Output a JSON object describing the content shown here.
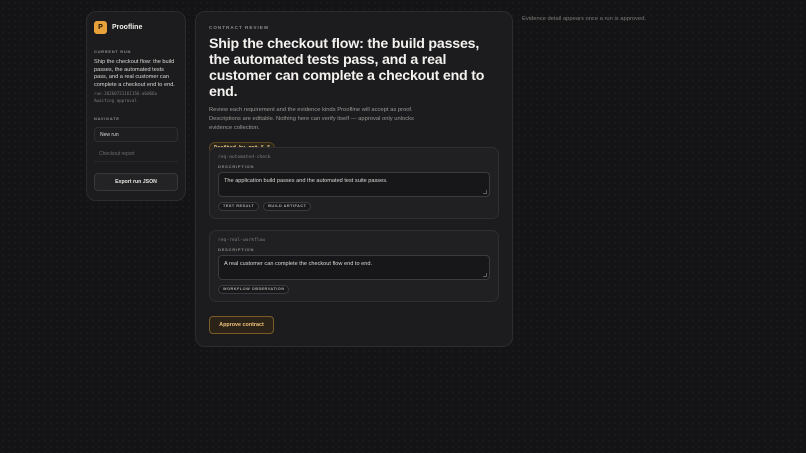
{
  "sidebar": {
    "brand": {
      "logo_letter": "P",
      "name": "Proofline"
    },
    "current_run": {
      "label": "CURRENT RUN",
      "title": "Ship the checkout flow: the build passes, the automated tests pass, and a real customer can complete a checkout end to end.",
      "run_id": "run-20260721161156-a6d66a",
      "status": "Awaiting approval"
    },
    "navigate": {
      "label": "NAVIGATE",
      "items": [
        {
          "label": "New run"
        },
        {
          "label": "Checkout report"
        }
      ]
    },
    "export_label": "Export run JSON"
  },
  "main": {
    "eyebrow": "CONTRACT REVIEW",
    "title": "Ship the checkout flow: the build passes, the automated tests pass, and a real customer can complete a checkout end to end.",
    "description": "Review each requirement and the evidence kinds Proofline will accept as proof. Descriptions are editable. Nothing here can verify itself — approval only unlocks evidence collection.",
    "drafted_badge": "Drafted by gpt-5.5",
    "requirements": [
      {
        "id": "req-automated-check",
        "description_label": "DESCRIPTION",
        "description": "The application build passes and the automated test suite passes.",
        "evidence_kinds": [
          "TEST RESULT",
          "BUILD ARTIFACT"
        ]
      },
      {
        "id": "req-real-workflow",
        "description_label": "DESCRIPTION",
        "description": "A real customer can complete the checkout flow end to end.",
        "evidence_kinds": [
          "WORKFLOW OBSERVATION"
        ]
      }
    ],
    "approve_label": "Approve contract"
  },
  "evidence_panel": {
    "note": "Evidence detail appears once a run is approved."
  },
  "colors": {
    "accent": "#e8a23a",
    "background": "#141416",
    "panel": "#1c1c1f"
  }
}
